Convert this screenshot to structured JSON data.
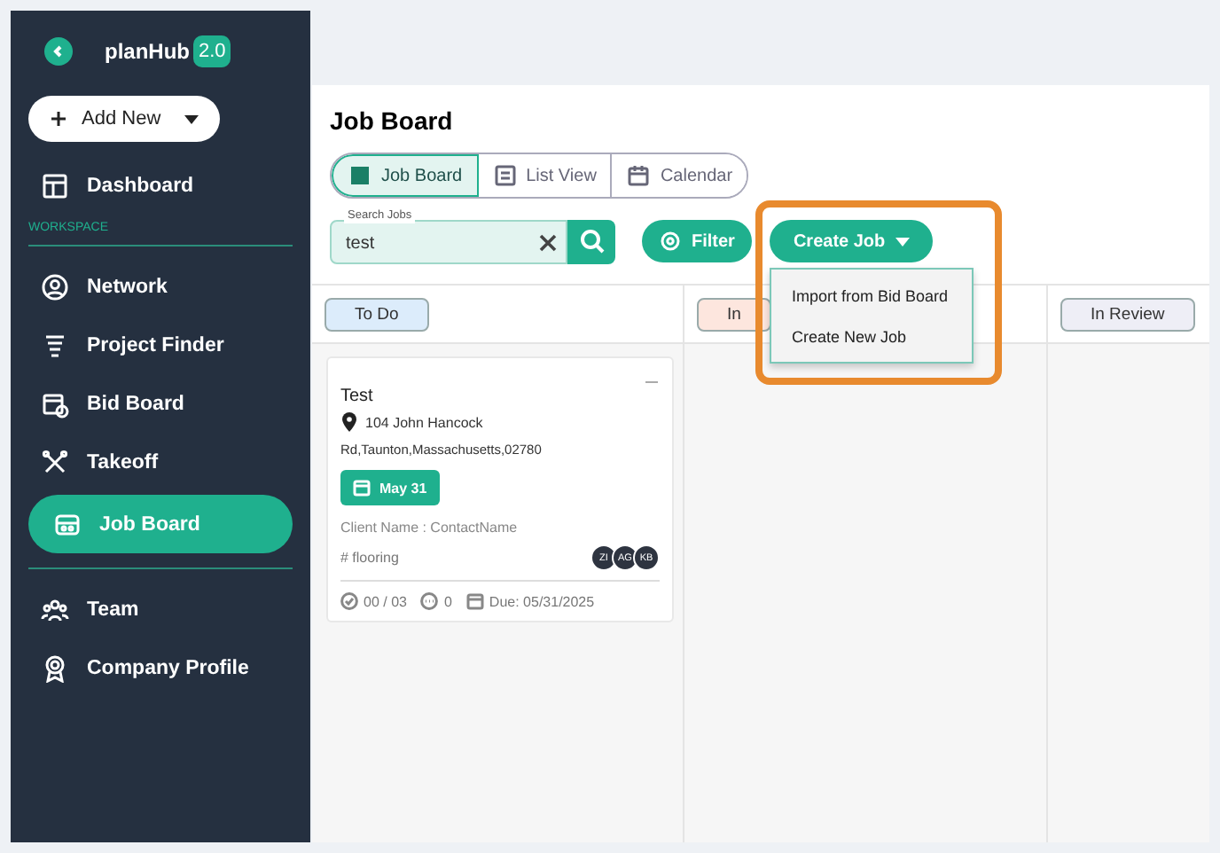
{
  "sidebar": {
    "logo": "planHub",
    "version": "2.0",
    "add_button": "Add New",
    "top_items": [
      {
        "label": "Dashboard",
        "selected": false
      }
    ],
    "section_label": "WORKSPACE",
    "items": [
      {
        "label": "Network",
        "selected": false
      },
      {
        "label": "Project Finder",
        "selected": false
      },
      {
        "label": "Bid Board",
        "selected": false
      },
      {
        "label": "Takeoff",
        "selected": false
      },
      {
        "label": "Job Board",
        "selected": true
      }
    ],
    "bottom_items": [
      {
        "label": "Team",
        "selected": false
      },
      {
        "label": "Company Profile",
        "selected": false
      }
    ]
  },
  "page_title": "Job Board",
  "view_tabs": [
    {
      "label": "Job Board",
      "selected": true
    },
    {
      "label": "List View",
      "selected": false
    },
    {
      "label": "Calendar",
      "selected": false
    }
  ],
  "search": {
    "label": "Search Jobs",
    "value": "test"
  },
  "filter_button": "Filter",
  "create_button": "Create Job",
  "create_menu": {
    "items": [
      "Import from Bid Board",
      "Create New Job"
    ]
  },
  "columns": [
    {
      "status": "To Do",
      "color": "#dcecfb"
    },
    {
      "status": "In",
      "color": "#fde6de"
    },
    {
      "status": "In Review",
      "color": "#eeeef6"
    }
  ],
  "cards": [
    {
      "title": "Test",
      "address_line1": "104 John Hancock",
      "address_line2": "Rd,Taunton,Massachusetts,02780",
      "date": "May 31",
      "client": "Client Name : ContactName",
      "tag": "# flooring",
      "avatars": [
        "ZI",
        "AG",
        "KB"
      ],
      "tasks": "00 / 03",
      "comments": "0",
      "due": "Due: 05/31/2025"
    }
  ]
}
